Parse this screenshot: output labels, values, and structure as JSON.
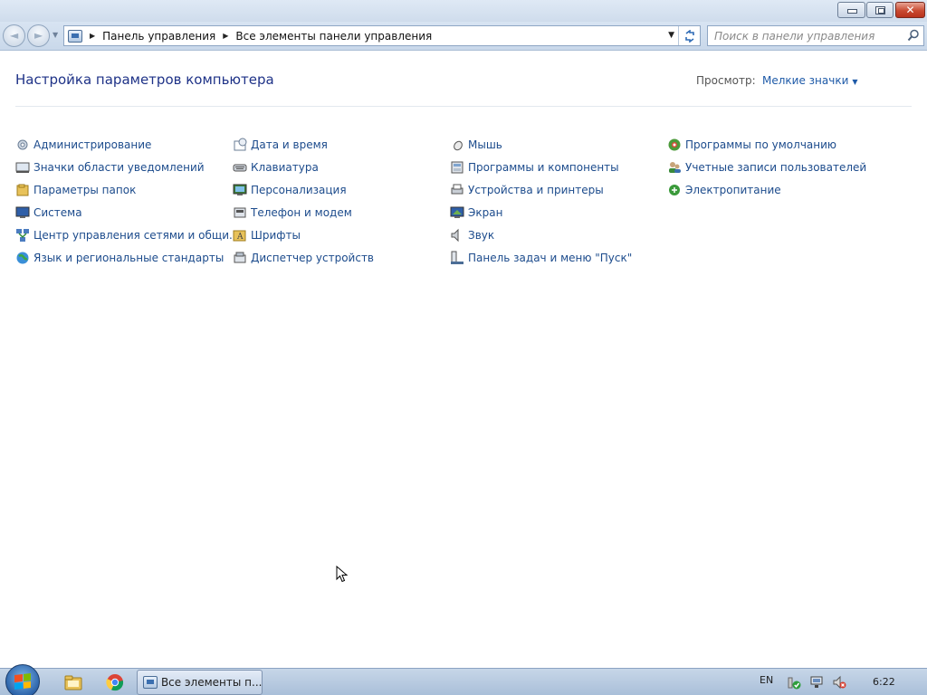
{
  "window": {
    "minimize_glyph": "—",
    "close_glyph": "✕"
  },
  "navigation": {
    "back_arrow": "◄",
    "forward_arrow": "►",
    "address": {
      "icon": "control-panel-icon",
      "crumbs": [
        "Панель управления",
        "Все элементы панели управления"
      ]
    },
    "search": {
      "placeholder": "Поиск в панели управления"
    }
  },
  "main": {
    "title": "Настройка параметров компьютера",
    "view_label": "Просмотр:",
    "view_value": "Мелкие значки",
    "items": [
      {
        "label": "Администрирование",
        "icon": "admin-tools-icon"
      },
      {
        "label": "Значки области уведомлений",
        "icon": "notification-icons-icon"
      },
      {
        "label": "Параметры папок",
        "icon": "folder-options-icon"
      },
      {
        "label": "Система",
        "icon": "system-icon"
      },
      {
        "label": "Центр управления сетями и общи...",
        "icon": "network-center-icon"
      },
      {
        "label": "Язык и региональные стандарты",
        "icon": "region-language-icon"
      },
      {
        "label": "Дата и время",
        "icon": "date-time-icon"
      },
      {
        "label": "Клавиатура",
        "icon": "keyboard-icon"
      },
      {
        "label": "Персонализация",
        "icon": "personalization-icon"
      },
      {
        "label": "Телефон и модем",
        "icon": "phone-modem-icon"
      },
      {
        "label": "Шрифты",
        "icon": "fonts-icon"
      },
      {
        "label": "Диспетчер устройств",
        "icon": "device-manager-icon"
      },
      {
        "label": "Мышь",
        "icon": "mouse-icon"
      },
      {
        "label": "Программы и компоненты",
        "icon": "programs-features-icon"
      },
      {
        "label": "Устройства и принтеры",
        "icon": "devices-printers-icon"
      },
      {
        "label": "Экран",
        "icon": "display-icon"
      },
      {
        "label": "Звук",
        "icon": "sound-icon"
      },
      {
        "label": "Панель задач и меню \"Пуск\"",
        "icon": "taskbar-start-menu-icon"
      },
      {
        "label": "Программы по умолчанию",
        "icon": "default-programs-icon"
      },
      {
        "label": "Учетные записи пользователей",
        "icon": "user-accounts-icon"
      },
      {
        "label": "Электропитание",
        "icon": "power-options-icon"
      }
    ]
  },
  "taskbar": {
    "active_task": "Все элементы п...",
    "language": "EN",
    "clock": "6:22"
  },
  "colors": {
    "link": "#1c4b8c",
    "title": "#1e3287",
    "view_link": "#1e5aa8"
  }
}
